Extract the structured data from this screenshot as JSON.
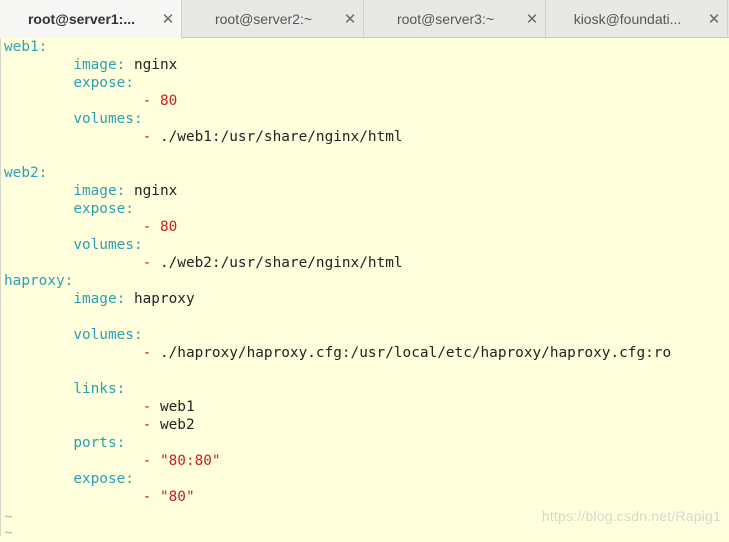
{
  "tabs": [
    {
      "label": "root@server1:...",
      "close": "✕",
      "active": true
    },
    {
      "label": "root@server2:~",
      "close": "✕",
      "active": false
    },
    {
      "label": "root@server3:~",
      "close": "✕",
      "active": false
    },
    {
      "label": "kiosk@foundati...",
      "close": "✕",
      "active": false
    }
  ],
  "terminal": {
    "colors": {
      "key": "#2aa1b3",
      "value": "#222222",
      "number": "#cc1f1f",
      "background": "#ffffdd"
    },
    "lines": {
      "web1_key": "web1",
      "colon": ":",
      "web1_image_key": "image",
      "web1_image_val": "nginx",
      "web1_expose_key": "expose",
      "web1_expose_dash": "- ",
      "web1_expose_val": "80",
      "web1_volumes_key": "volumes",
      "web1_volumes_dash": "- ",
      "web1_volumes_val": "./web1:/usr/share/nginx/html",
      "web2_key": "web2",
      "web2_image_key": "image",
      "web2_image_val": "nginx",
      "web2_expose_key": "expose",
      "web2_expose_dash": "- ",
      "web2_expose_val": "80",
      "web2_volumes_key": "volumes",
      "web2_volumes_dash": "- ",
      "web2_volumes_val": "./web2:/usr/share/nginx/html",
      "haproxy_key": "haproxy",
      "haproxy_image_key": "image",
      "haproxy_image_val": "haproxy",
      "haproxy_volumes_key": "volumes",
      "haproxy_volumes_dash": "- ",
      "haproxy_volumes_val": "./haproxy/haproxy.cfg:/usr/local/etc/haproxy/haproxy.cfg:ro",
      "haproxy_links_key": "links",
      "haproxy_links_dash": "- ",
      "haproxy_link1": "web1",
      "haproxy_link2": "web2",
      "haproxy_ports_key": "ports",
      "haproxy_ports_dash": "- ",
      "haproxy_ports_val": "\"80:80\"",
      "haproxy_expose_key": "expose",
      "haproxy_expose_dash": "- ",
      "haproxy_expose_val": "\"80\"",
      "tilde": "~"
    }
  },
  "watermark": "https://blog.csdn.net/Rapig1"
}
